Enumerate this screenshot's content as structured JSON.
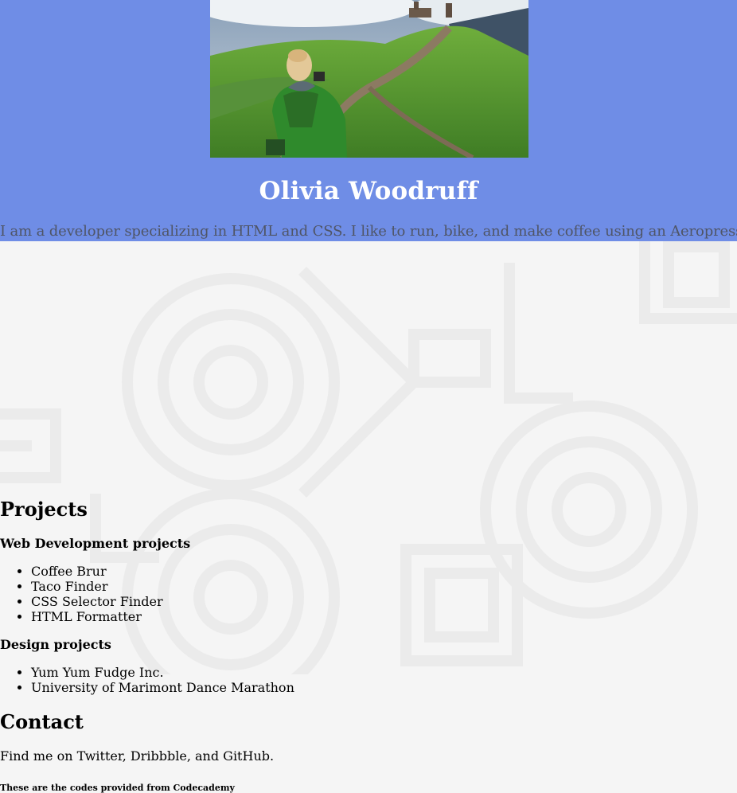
{
  "header": {
    "name": "Olivia Woodruff",
    "bio": "I am a developer specializing in HTML and CSS. I like to run, bike, and make coffee using an Aeropress."
  },
  "projects": {
    "title": "Projects",
    "web": {
      "heading": "Web Development projects",
      "items": [
        "Coffee Brur",
        "Taco Finder",
        "CSS Selector Finder",
        "HTML Formatter"
      ]
    },
    "design": {
      "heading": "Design projects",
      "items": [
        "Yum Yum Fudge Inc.",
        "University of Marimont Dance Marathon"
      ]
    }
  },
  "contact": {
    "title": "Contact",
    "text": "Find me on Twitter, Dribbble, and GitHub."
  },
  "footer": {
    "credit": "These are the codes provided from Codecademy"
  },
  "colors": {
    "header_bg": "#6f8de6",
    "page_bg": "#f5f5f5",
    "name_color": "#ffffff",
    "bio_color": "#4f5566"
  }
}
